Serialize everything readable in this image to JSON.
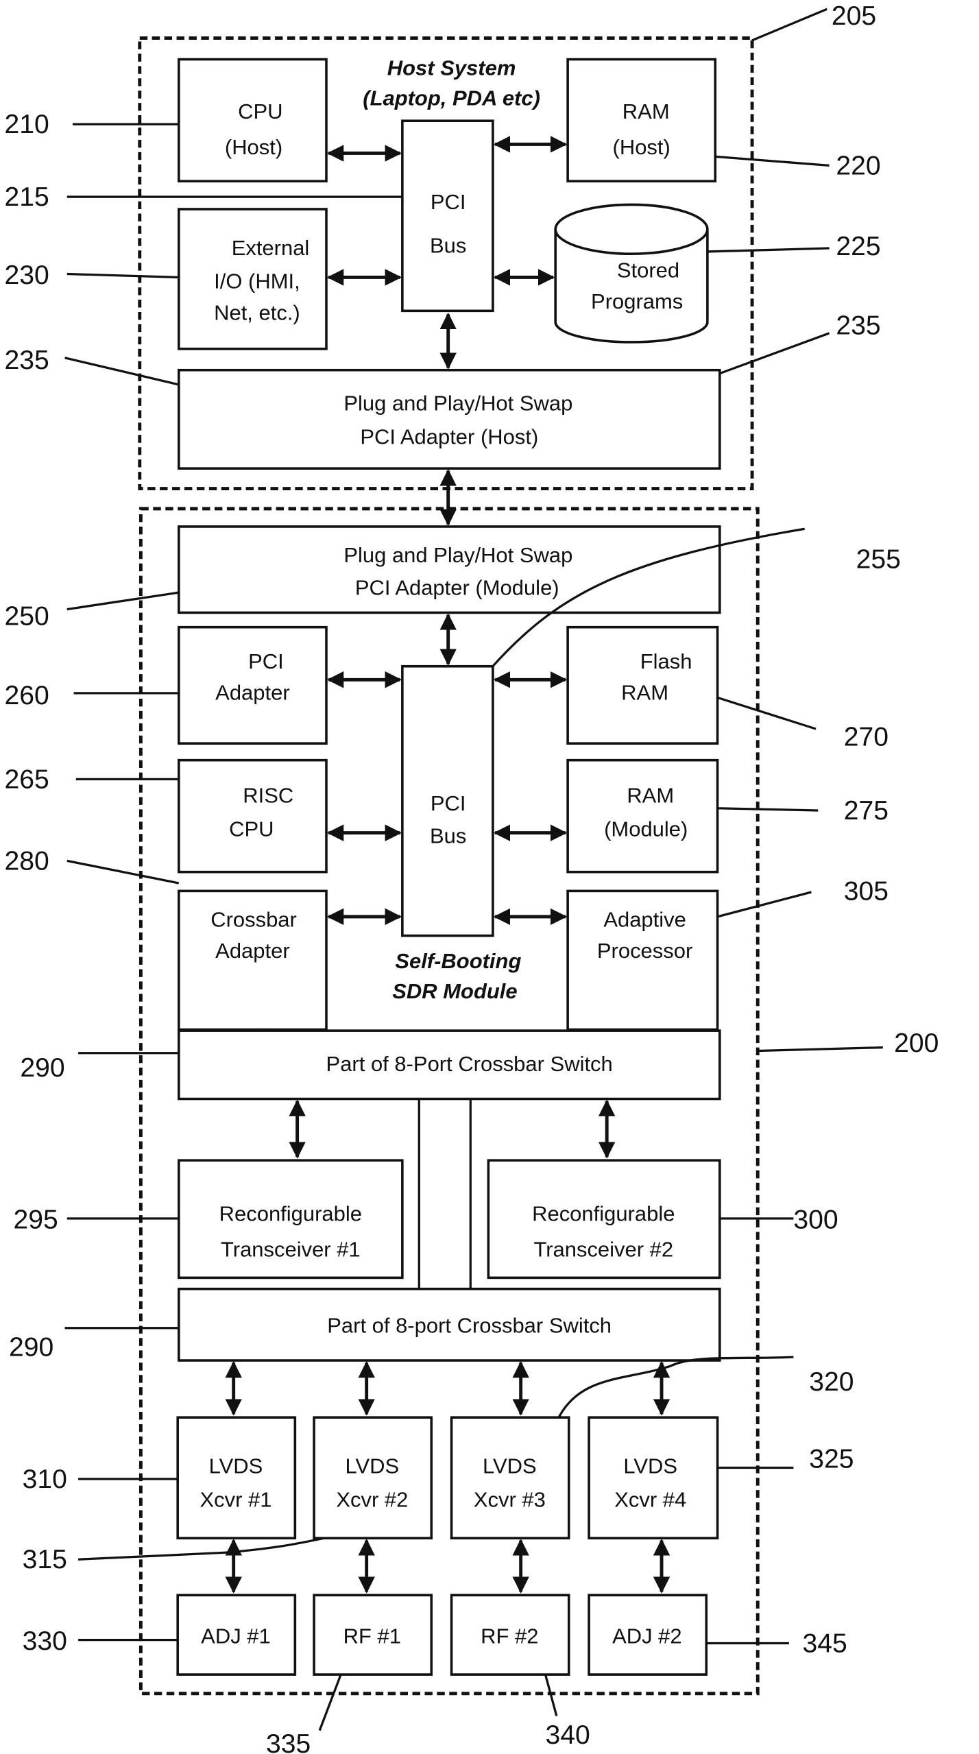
{
  "host": {
    "title": [
      "Host System",
      "(Laptop, PDA etc)"
    ],
    "cpu": [
      "CPU",
      "(Host)"
    ],
    "ram": [
      "RAM",
      "(Host)"
    ],
    "bus": [
      "PCI",
      "Bus"
    ],
    "ext_io": [
      "External",
      "I/O (HMI,",
      "Net, etc.)"
    ],
    "stored": [
      "Stored",
      "Programs"
    ],
    "adapter": [
      "Plug and Play/Hot Swap",
      "PCI Adapter (Host)"
    ]
  },
  "module": {
    "title": [
      "Self-Booting",
      "SDR Module"
    ],
    "adapter": [
      "Plug and Play/Hot Swap",
      "PCI Adapter (Module)"
    ],
    "pci_adapter": [
      "PCI",
      "Adapter"
    ],
    "risc": [
      "RISC",
      "CPU"
    ],
    "crossbar_adapter": [
      "Crossbar",
      "Adapter"
    ],
    "bus": [
      "PCI",
      "Bus"
    ],
    "flash": [
      "Flash",
      "RAM"
    ],
    "ram": [
      "RAM",
      "(Module)"
    ],
    "adaptive": [
      "Adaptive",
      "Processor"
    ],
    "crossbar_top": "Part of 8-Port Crossbar Switch",
    "crossbar_bottom": "Part of 8-port Crossbar Switch",
    "xcvr1": [
      "Reconfigurable",
      "Transceiver #1"
    ],
    "xcvr2": [
      "Reconfigurable",
      "Transceiver #2"
    ],
    "lvds": [
      [
        "LVDS",
        "Xcvr #1"
      ],
      [
        "LVDS",
        "Xcvr #2"
      ],
      [
        "LVDS",
        "Xcvr #3"
      ],
      [
        "LVDS",
        "Xcvr #4"
      ]
    ],
    "outputs": [
      "ADJ #1",
      "RF #1",
      "RF #2",
      "ADJ #2"
    ]
  },
  "refs": {
    "r205": "205",
    "r210": "210",
    "r215": "215",
    "r220": "220",
    "r225": "225",
    "r230": "230",
    "r235a": "235",
    "r235b": "235",
    "r250": "250",
    "r255": "255",
    "r260": "260",
    "r265": "265",
    "r270": "270",
    "r275": "275",
    "r280": "280",
    "r305": "305",
    "r290a": "290",
    "r200": "200",
    "r295": "295",
    "r300": "300",
    "r290b": "290",
    "r320": "320",
    "r310": "310",
    "r325": "325",
    "r315": "315",
    "r330": "330",
    "r345": "345",
    "r335": "335",
    "r340": "340"
  }
}
